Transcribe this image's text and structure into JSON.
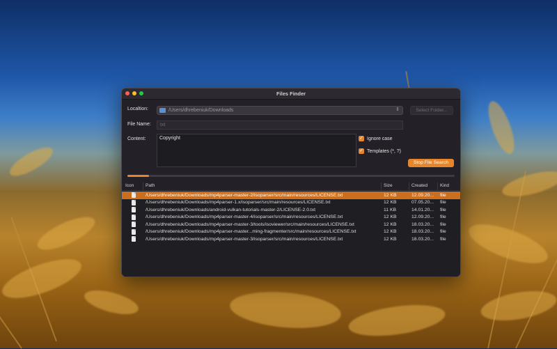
{
  "window": {
    "title": "Files Finder"
  },
  "form": {
    "location_label": "Localtion:",
    "location_path": "/Users/dhrebeniuk/Downloads",
    "select_folder_label": "Select Folder...",
    "file_name_label": "File Name:",
    "file_name_value": "txt",
    "content_label": "Content:",
    "content_value": "Copyright",
    "ignore_case_label": "Ignore case",
    "templates_label": "Templates (*, ?)",
    "stop_button_label": "Stop File Search",
    "progress_fraction": 0.065,
    "accent_color": "#e6862c"
  },
  "table": {
    "headers": [
      "Icon",
      "Path",
      "Size",
      "Created",
      "Kind"
    ],
    "rows": [
      {
        "path": "/Users/dhrebeniuk/Downloads/mp4parser-master-2/isoparser/src/main/resources/LICENSE.txt",
        "size": "12 KB",
        "created": "12.09.20...",
        "kind": "file",
        "selected": true
      },
      {
        "path": "/Users/dhrebeniuk/Downloads/mp4parser-1.x/isoparser/src/main/resources/LICENSE.txt",
        "size": "12 KB",
        "created": "07.05.20...",
        "kind": "file"
      },
      {
        "path": "/Users/dhrebeniuk/Downloads/android-vulkan-tutorials-master-2/LICENSE-2.0.txt",
        "size": "11 KB",
        "created": "14.01.20...",
        "kind": "file"
      },
      {
        "path": "/Users/dhrebeniuk/Downloads/mp4parser-master-4/isoparser/src/main/resources/LICENSE.txt",
        "size": "12 KB",
        "created": "12.09.20...",
        "kind": "file"
      },
      {
        "path": "/Users/dhrebeniuk/Downloads/mp4parser-master-3/tools/isoviewer/src/main/resources/LICENSE.txt",
        "size": "12 KB",
        "created": "18.03.20...",
        "kind": "file"
      },
      {
        "path": "/Users/dhrebeniuk/Downloads/mp4parser-master...ming-fragmenter/src/main/resources/LICENSE.txt",
        "size": "12 KB",
        "created": "18.03.20...",
        "kind": "file"
      },
      {
        "path": "/Users/dhrebeniuk/Downloads/mp4parser-master-3/isoparser/src/main/resources/LICENSE.txt",
        "size": "12 KB",
        "created": "18.03.20...",
        "kind": "file"
      }
    ]
  }
}
